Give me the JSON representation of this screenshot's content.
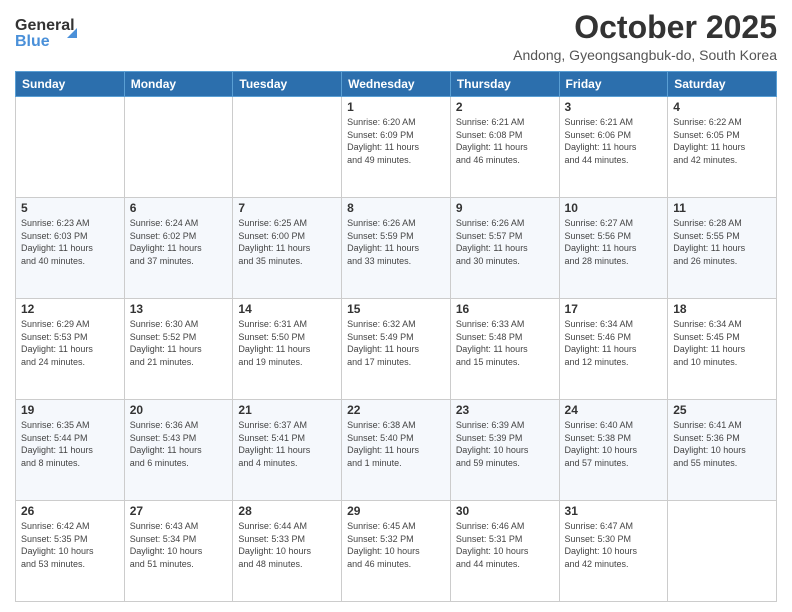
{
  "header": {
    "logo_line1": "General",
    "logo_line2": "Blue",
    "month_title": "October 2025",
    "location": "Andong, Gyeongsangbuk-do, South Korea"
  },
  "days_of_week": [
    "Sunday",
    "Monday",
    "Tuesday",
    "Wednesday",
    "Thursday",
    "Friday",
    "Saturday"
  ],
  "weeks": [
    [
      {
        "day": "",
        "info": ""
      },
      {
        "day": "",
        "info": ""
      },
      {
        "day": "",
        "info": ""
      },
      {
        "day": "1",
        "info": "Sunrise: 6:20 AM\nSunset: 6:09 PM\nDaylight: 11 hours\nand 49 minutes."
      },
      {
        "day": "2",
        "info": "Sunrise: 6:21 AM\nSunset: 6:08 PM\nDaylight: 11 hours\nand 46 minutes."
      },
      {
        "day": "3",
        "info": "Sunrise: 6:21 AM\nSunset: 6:06 PM\nDaylight: 11 hours\nand 44 minutes."
      },
      {
        "day": "4",
        "info": "Sunrise: 6:22 AM\nSunset: 6:05 PM\nDaylight: 11 hours\nand 42 minutes."
      }
    ],
    [
      {
        "day": "5",
        "info": "Sunrise: 6:23 AM\nSunset: 6:03 PM\nDaylight: 11 hours\nand 40 minutes."
      },
      {
        "day": "6",
        "info": "Sunrise: 6:24 AM\nSunset: 6:02 PM\nDaylight: 11 hours\nand 37 minutes."
      },
      {
        "day": "7",
        "info": "Sunrise: 6:25 AM\nSunset: 6:00 PM\nDaylight: 11 hours\nand 35 minutes."
      },
      {
        "day": "8",
        "info": "Sunrise: 6:26 AM\nSunset: 5:59 PM\nDaylight: 11 hours\nand 33 minutes."
      },
      {
        "day": "9",
        "info": "Sunrise: 6:26 AM\nSunset: 5:57 PM\nDaylight: 11 hours\nand 30 minutes."
      },
      {
        "day": "10",
        "info": "Sunrise: 6:27 AM\nSunset: 5:56 PM\nDaylight: 11 hours\nand 28 minutes."
      },
      {
        "day": "11",
        "info": "Sunrise: 6:28 AM\nSunset: 5:55 PM\nDaylight: 11 hours\nand 26 minutes."
      }
    ],
    [
      {
        "day": "12",
        "info": "Sunrise: 6:29 AM\nSunset: 5:53 PM\nDaylight: 11 hours\nand 24 minutes."
      },
      {
        "day": "13",
        "info": "Sunrise: 6:30 AM\nSunset: 5:52 PM\nDaylight: 11 hours\nand 21 minutes."
      },
      {
        "day": "14",
        "info": "Sunrise: 6:31 AM\nSunset: 5:50 PM\nDaylight: 11 hours\nand 19 minutes."
      },
      {
        "day": "15",
        "info": "Sunrise: 6:32 AM\nSunset: 5:49 PM\nDaylight: 11 hours\nand 17 minutes."
      },
      {
        "day": "16",
        "info": "Sunrise: 6:33 AM\nSunset: 5:48 PM\nDaylight: 11 hours\nand 15 minutes."
      },
      {
        "day": "17",
        "info": "Sunrise: 6:34 AM\nSunset: 5:46 PM\nDaylight: 11 hours\nand 12 minutes."
      },
      {
        "day": "18",
        "info": "Sunrise: 6:34 AM\nSunset: 5:45 PM\nDaylight: 11 hours\nand 10 minutes."
      }
    ],
    [
      {
        "day": "19",
        "info": "Sunrise: 6:35 AM\nSunset: 5:44 PM\nDaylight: 11 hours\nand 8 minutes."
      },
      {
        "day": "20",
        "info": "Sunrise: 6:36 AM\nSunset: 5:43 PM\nDaylight: 11 hours\nand 6 minutes."
      },
      {
        "day": "21",
        "info": "Sunrise: 6:37 AM\nSunset: 5:41 PM\nDaylight: 11 hours\nand 4 minutes."
      },
      {
        "day": "22",
        "info": "Sunrise: 6:38 AM\nSunset: 5:40 PM\nDaylight: 11 hours\nand 1 minute."
      },
      {
        "day": "23",
        "info": "Sunrise: 6:39 AM\nSunset: 5:39 PM\nDaylight: 10 hours\nand 59 minutes."
      },
      {
        "day": "24",
        "info": "Sunrise: 6:40 AM\nSunset: 5:38 PM\nDaylight: 10 hours\nand 57 minutes."
      },
      {
        "day": "25",
        "info": "Sunrise: 6:41 AM\nSunset: 5:36 PM\nDaylight: 10 hours\nand 55 minutes."
      }
    ],
    [
      {
        "day": "26",
        "info": "Sunrise: 6:42 AM\nSunset: 5:35 PM\nDaylight: 10 hours\nand 53 minutes."
      },
      {
        "day": "27",
        "info": "Sunrise: 6:43 AM\nSunset: 5:34 PM\nDaylight: 10 hours\nand 51 minutes."
      },
      {
        "day": "28",
        "info": "Sunrise: 6:44 AM\nSunset: 5:33 PM\nDaylight: 10 hours\nand 48 minutes."
      },
      {
        "day": "29",
        "info": "Sunrise: 6:45 AM\nSunset: 5:32 PM\nDaylight: 10 hours\nand 46 minutes."
      },
      {
        "day": "30",
        "info": "Sunrise: 6:46 AM\nSunset: 5:31 PM\nDaylight: 10 hours\nand 44 minutes."
      },
      {
        "day": "31",
        "info": "Sunrise: 6:47 AM\nSunset: 5:30 PM\nDaylight: 10 hours\nand 42 minutes."
      },
      {
        "day": "",
        "info": ""
      }
    ]
  ]
}
